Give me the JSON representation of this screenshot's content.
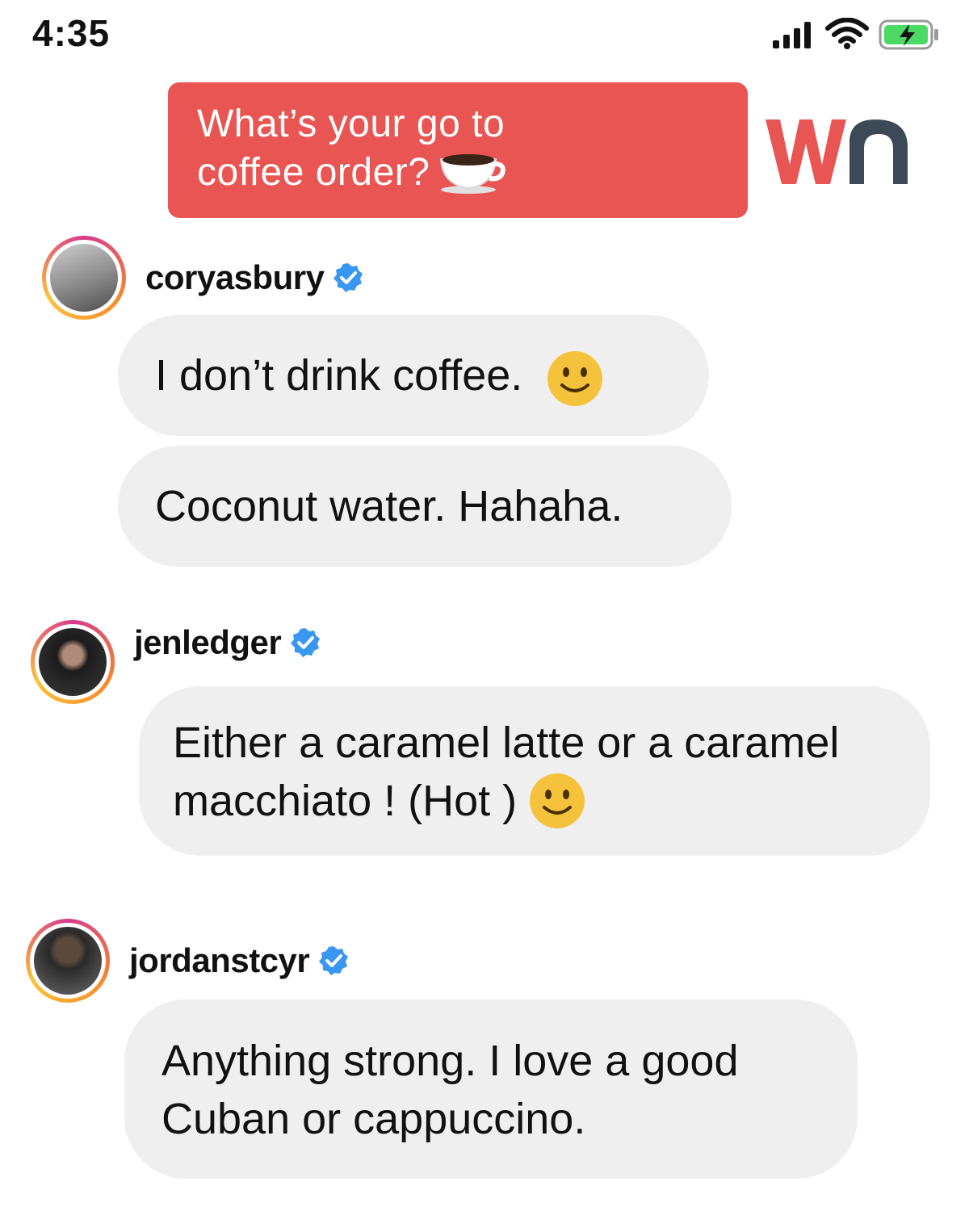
{
  "status_bar": {
    "time": "4:35",
    "icons": [
      "cellular-signal-icon",
      "wifi-icon",
      "battery-charging-icon"
    ],
    "battery_color": "#4cd964"
  },
  "question": {
    "line1": "What’s your go to",
    "line2": "coffee order?",
    "icon": "coffee-cup-icon",
    "background_color": "#e85552"
  },
  "logo": {
    "text": "wn",
    "colors": {
      "w": "#e85552",
      "n": "#3b4a56"
    }
  },
  "posts": [
    {
      "username": "coryasbury",
      "verified": true,
      "messages": [
        {
          "text": "I don’t drink coffee.",
          "emoji": "smiling-face-icon"
        },
        {
          "text": "Coconut water. Hahaha."
        }
      ]
    },
    {
      "username": "jenledger",
      "verified": true,
      "messages": [
        {
          "line1": "Either a caramel latte or a caramel",
          "line2": "macchiato ! (Hot )",
          "emoji": "smiling-face-icon"
        }
      ]
    },
    {
      "username": "jordanstcyr",
      "verified": true,
      "messages": [
        {
          "line1": "Anything strong. I love a good",
          "line2": "Cuban or cappuccino."
        }
      ]
    }
  ],
  "colors": {
    "bubble": "#efefef",
    "verified_badge": "#3897f0",
    "avatar_ring": [
      "#d83a8c",
      "#f58a2b",
      "#fcc23b"
    ]
  }
}
